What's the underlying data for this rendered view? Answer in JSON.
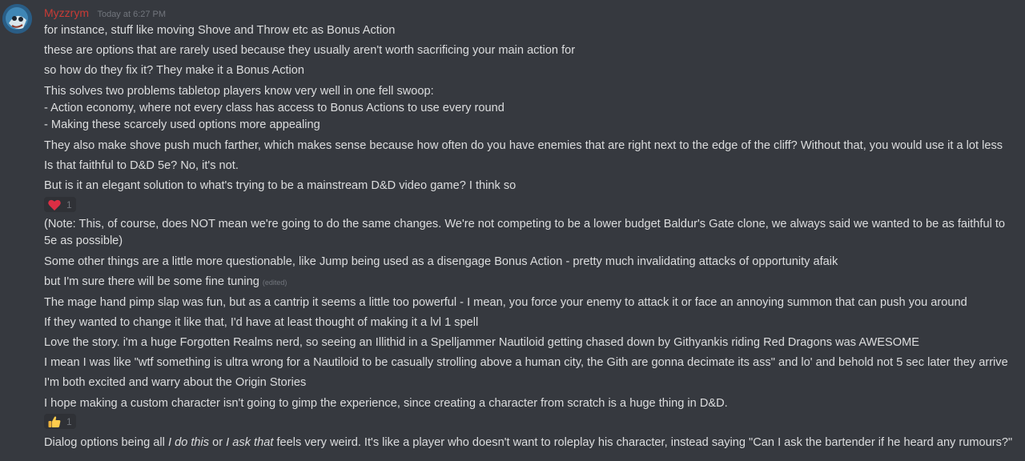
{
  "message": {
    "author": "Myzzrym",
    "timestamp": "Today at 6:27 PM",
    "lines": [
      "for instance, stuff like moving Shove and Throw etc as Bonus Action",
      "these are options that are rarely used because they usually aren't worth sacrificing your main action for",
      "so how do they fix it? They make it a Bonus Action",
      "This solves two problems tabletop players know very well in one fell swoop:",
      "- Action economy, where not every class has access to Bonus Actions to use every round",
      "- Making these scarcely used options more appealing",
      "They also make shove push much farther, which makes sense because how often do you have enemies that are right next to the edge of the cliff? Without that, you would use it a lot less",
      "Is that faithful to D&D 5e? No, it's not.",
      "But is it an elegant solution to what's trying to be a mainstream D&D video game? I think so",
      "(Note: This, of course, does NOT mean we're going to do the same changes. We're not competing to be a lower budget Baldur's Gate clone, we always said we wanted to be as faithful to 5e as possible)",
      "Some other things are a little more questionable, like Jump being used as a disengage Bonus Action - pretty much invalidating attacks of opportunity afaik",
      "but I'm sure there will be some fine tuning",
      "The mage hand pimp slap was fun, but as a cantrip it seems a little too powerful - I mean, you force your enemy to attack it or face an annoying summon that can push you around",
      "If they wanted to change it like that, I'd have at least thought of making it a lvl 1 spell",
      "Love the story. i'm a huge Forgotten Realms nerd, so seeing an Illithid in a Spelljammer Nautiloid getting chased down by Githyankis riding Red Dragons was AWESOME",
      "I mean I was like \"wtf something is ultra wrong for a Nautiloid to be casually strolling above a human city, the Gith are gonna decimate its ass\" and lo' and behold not 5 sec later they arrive",
      "I'm both excited and warry about the Origin Stories",
      "I hope making a custom character isn't going to gimp the experience, since creating a character from scratch is a huge thing in D&D."
    ],
    "edited_label": "(edited)",
    "last_line": {
      "part1": "Dialog options being all ",
      "italic1": "I do this",
      "part2": " or ",
      "italic2": "I ask that",
      "part3": " feels very weird. It's like a player who doesn't want to roleplay his character, instead saying \"Can I ask the bartender if he heard any rumours?\""
    },
    "reactions": [
      {
        "emoji": "heart-icon",
        "count": "1"
      },
      {
        "emoji": "thumbs-up-icon",
        "count": "1"
      }
    ]
  },
  "colors": {
    "background": "#36393f",
    "username": "#c93b36",
    "text": "#dcddde",
    "muted": "#72767d",
    "reaction_bg": "#2f3136"
  }
}
